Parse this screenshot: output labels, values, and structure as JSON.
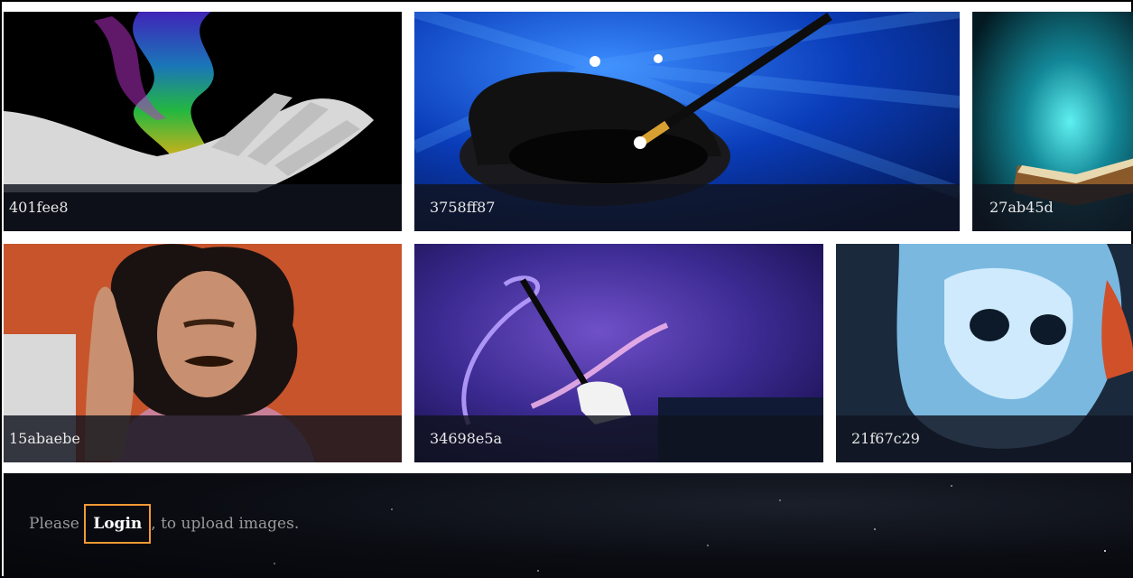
{
  "gallery": {
    "tiles": [
      {
        "id": "401fee8",
        "icon": "smoke-hand-icon"
      },
      {
        "id": "3758ff87",
        "icon": "magic-hat-wand-icon"
      },
      {
        "id": "27ab45d",
        "icon": "glowing-book-icon"
      },
      {
        "id": "15abaebe",
        "icon": "man-gesture-icon"
      },
      {
        "id": "34698e5a",
        "icon": "wand-sparkle-icon"
      },
      {
        "id": "21f67c29",
        "icon": "ice-skull-icon"
      }
    ]
  },
  "footer": {
    "prefix": "Please ",
    "login_label": "Login",
    "suffix": ", to upload images."
  },
  "colors": {
    "login_highlight": "#f39a35",
    "caption_bg": "#10141e"
  }
}
